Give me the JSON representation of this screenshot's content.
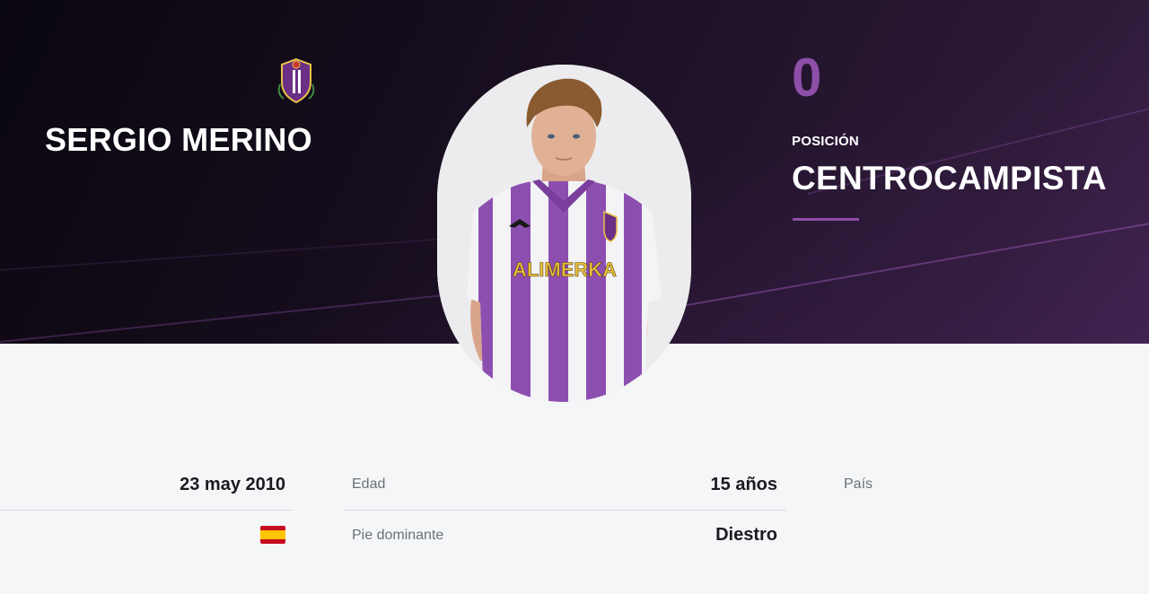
{
  "player": {
    "name": "SERGIO MERINO",
    "number": "0",
    "position_label": "POSICIÓN",
    "position": "CENTROCAMPISTA",
    "shirt_sponsor": "ALIMERKA",
    "club_crest_icon": "real-valladolid-crest-icon"
  },
  "details": {
    "birth_date_value": "23 may 2010",
    "age_label": "Edad",
    "age_value": "15 años",
    "country_label": "País",
    "country_flag_icon": "spain-flag-icon",
    "foot_label": "Pie dominante",
    "foot_value": "Diestro"
  },
  "colors": {
    "accent": "#8d4fa8",
    "hero_dark": "#0b0710",
    "hero_light": "#3a2147",
    "page_bg": "#f5f6f7"
  }
}
